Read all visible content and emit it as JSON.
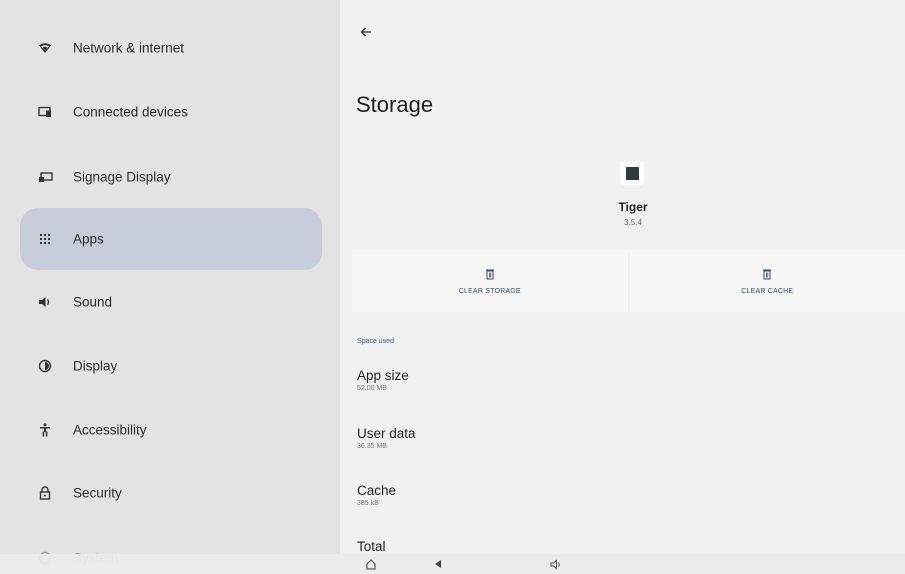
{
  "sidebar": {
    "items": [
      {
        "label": "Network & internet",
        "icon": "wifi-icon"
      },
      {
        "label": "Connected devices",
        "icon": "devices-icon"
      },
      {
        "label": "Signage Display",
        "icon": "display-screen-icon"
      },
      {
        "label": "Apps",
        "icon": "apps-grid-icon",
        "selected": true
      },
      {
        "label": "Sound",
        "icon": "speaker-icon"
      },
      {
        "label": "Display",
        "icon": "brightness-icon"
      },
      {
        "label": "Accessibility",
        "icon": "accessibility-icon"
      },
      {
        "label": "Security",
        "icon": "lock-icon"
      },
      {
        "label": "System",
        "icon": "info-icon"
      }
    ]
  },
  "main": {
    "title": "Storage",
    "app": {
      "name": "Tiger",
      "version": "3.5.4"
    },
    "actions": {
      "clear_storage": "CLEAR STORAGE",
      "clear_cache": "CLEAR CACHE"
    },
    "section_header": "Space used",
    "rows": [
      {
        "title": "App size",
        "value": "52.00 MB"
      },
      {
        "title": "User data",
        "value": "36.35 MB"
      },
      {
        "title": "Cache",
        "value": "385 kB"
      },
      {
        "title": "Total",
        "value": ""
      }
    ]
  },
  "colors": {
    "selected_bg": "#c8cddc",
    "accent": "#3f5a9c",
    "sidebar_bg": "#e3e3e3",
    "main_bg": "#f1f1f1"
  }
}
